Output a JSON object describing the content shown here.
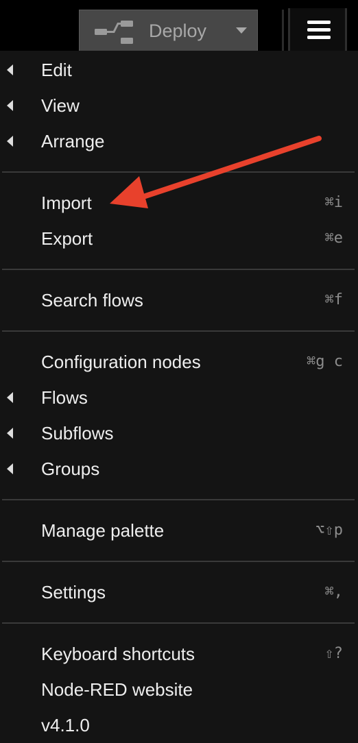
{
  "header": {
    "deploy_label": "Deploy",
    "icons": {
      "deploy": "flow-nodes-icon",
      "caret": "caret-down-icon",
      "menu": "hamburger-menu-icon"
    }
  },
  "menu": {
    "edit": "Edit",
    "view": "View",
    "arrange": "Arrange",
    "import": {
      "label": "Import",
      "shortcut": "⌘i"
    },
    "export": {
      "label": "Export",
      "shortcut": "⌘e"
    },
    "search": {
      "label": "Search flows",
      "shortcut": "⌘f"
    },
    "config": {
      "label": "Configuration nodes",
      "shortcut": "⌘g c"
    },
    "flows": "Flows",
    "subflows": "Subflows",
    "groups": "Groups",
    "palette": {
      "label": "Manage palette",
      "shortcut": "⌥⇧p"
    },
    "settings": {
      "label": "Settings",
      "shortcut": "⌘,"
    },
    "keyboard": {
      "label": "Keyboard shortcuts",
      "shortcut": "⇧?"
    },
    "website": "Node-RED website",
    "version": "v4.1.0"
  },
  "colors": {
    "menu_background": "#141414",
    "menu_text": "#eeeeee",
    "shortcut_text": "#8d8d8d",
    "deploy_button": "#474747",
    "annotation_arrow": "#e8412c"
  }
}
